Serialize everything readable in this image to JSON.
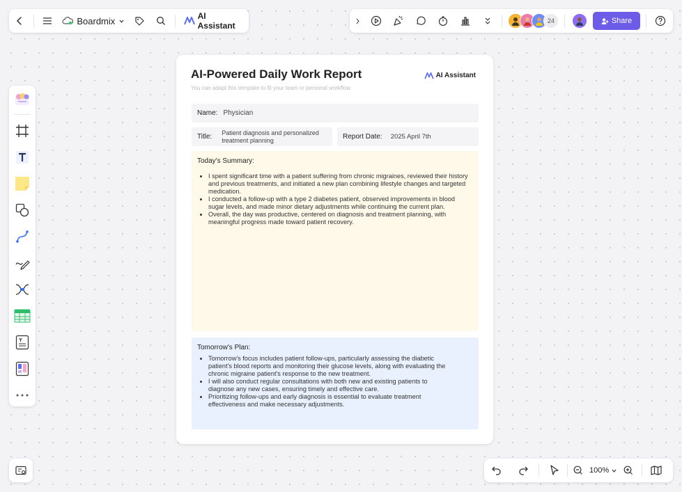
{
  "toolbar": {
    "brand_label": "Boardmix",
    "ai_label": "AI Assistant",
    "collaborator_count": "24",
    "share_label": "Share"
  },
  "zoom": {
    "level": "100%"
  },
  "doc": {
    "title": "AI-Powered Daily Work Report",
    "subtitle": "You can adapt this template to fit your team or personal workflow",
    "ai_label": "AI Assistant",
    "name_label": "Name:",
    "name_value": "Physician",
    "title_label": "Title:",
    "title_value": "Patient diagnosis and personalized treatment planning",
    "date_label": "Report Date:",
    "date_value": "2025 April 7th",
    "summary_heading": "Today's Summary:",
    "summary_items": [
      "I spent significant time with a patient suffering from chronic migraines, reviewed their history and previous treatments, and initiated a new plan combining lifestyle changes and targeted medication.",
      "I conducted a follow-up with a type 2 diabetes patient, observed improvements in blood sugar levels, and made minor dietary adjustments while continuing the current plan.",
      "Overall, the day was productive, centered on diagnosis and treatment planning, with meaningful progress made toward patient recovery."
    ],
    "plan_heading": "Tomorrow's Plan:",
    "plan_items": [
      "Tomorrow's focus includes patient follow-ups, particularly assessing the diabetic patient's blood reports and monitoring their glucose levels, along with evaluating the chronic migraine patient's response to the new treatment.",
      "I will also conduct regular consultations with both new and existing patients to diagnose any new cases, ensuring timely and effective care.",
      "Prioritizing follow-ups and early diagnosis is essential to evaluate treatment effectiveness and make necessary adjustments."
    ]
  },
  "colors": {
    "accent": "#6c5ce7",
    "summary_bg": "#fff9ea",
    "plan_bg": "#eaf1fe"
  }
}
